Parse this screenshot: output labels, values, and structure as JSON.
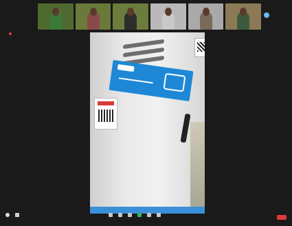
{
  "meeting": {
    "window_title": "",
    "top_right_text": "",
    "recording_pill": "",
    "recording_text": ""
  },
  "thumbnails": [
    {
      "name": "",
      "bg": "#4f6a2f",
      "shirt": "#3b7a3a"
    },
    {
      "name": "",
      "bg": "#6a7a3a",
      "shirt": "#8a4a4a"
    },
    {
      "name": "",
      "bg": "#6b7c3d",
      "shirt": "#2d2d2d"
    },
    {
      "name": "",
      "bg": "#b9b9b9",
      "shirt": "#c9c9c9"
    },
    {
      "name": "",
      "bg": "#a9a9a9",
      "shirt": "#7a6a5a"
    },
    {
      "name": "",
      "bg": "#8b7a55",
      "shirt": "#3c5b3c"
    }
  ],
  "controls": {
    "left": [
      {
        "label": "",
        "icon": "microphone-icon"
      },
      {
        "label": "",
        "icon": "video-camera-icon"
      }
    ],
    "center": [
      {
        "label": "",
        "icon": "security-icon"
      },
      {
        "label": "",
        "icon": "participants-icon"
      },
      {
        "label": "",
        "icon": "chat-icon"
      },
      {
        "label": "",
        "icon": "share-screen-icon"
      },
      {
        "label": "",
        "icon": "record-icon"
      },
      {
        "label": "",
        "icon": "reactions-icon"
      }
    ],
    "end_label": ""
  },
  "bottom_left_label": "",
  "colors": {
    "record": "#e53b3b",
    "share": "#32b35b",
    "end": "#e03b3b"
  }
}
